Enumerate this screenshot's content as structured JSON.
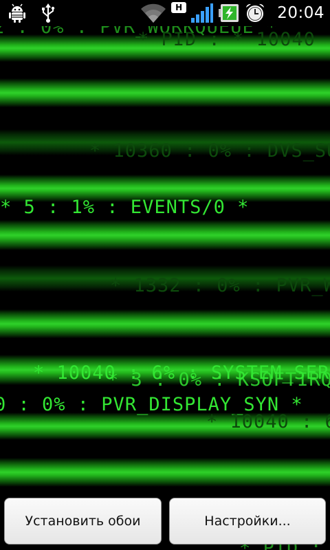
{
  "status_bar": {
    "left_icons": [
      "android-debug-icon",
      "usb-icon"
    ],
    "network_badge": "H",
    "clock": "20:04"
  },
  "wallpaper": {
    "lines": [
      {
        "id": "l1",
        "text": "2 : 0% : PVR_WORKQUEUE *"
      },
      {
        "id": "l2",
        "text": "* PID : * 10040"
      },
      {
        "id": "l3",
        "text": "* 10360 : 0% : DVS_SU"
      },
      {
        "id": "l4",
        "text": "* 5 : 1% : EVENTS/0 *"
      },
      {
        "id": "l5",
        "text": "* 1332 : 0% : PVR_W"
      },
      {
        "id": "l6",
        "text": "* 10040 : 6% : SYSTEM_SERV"
      },
      {
        "id": "l7",
        "text": "* 3 : 0% : KSOFTIRQ"
      },
      {
        "id": "l8",
        "text": "0 : 0% : PVR_DISPLAY_SYN *"
      },
      {
        "id": "l9",
        "text": "* 10040 : 6"
      },
      {
        "id": "l10",
        "text": "* PID : *"
      }
    ],
    "accent_color": "#2fd12a"
  },
  "buttons": {
    "set_wallpaper": "Установить обои",
    "settings": "Настройки..."
  }
}
